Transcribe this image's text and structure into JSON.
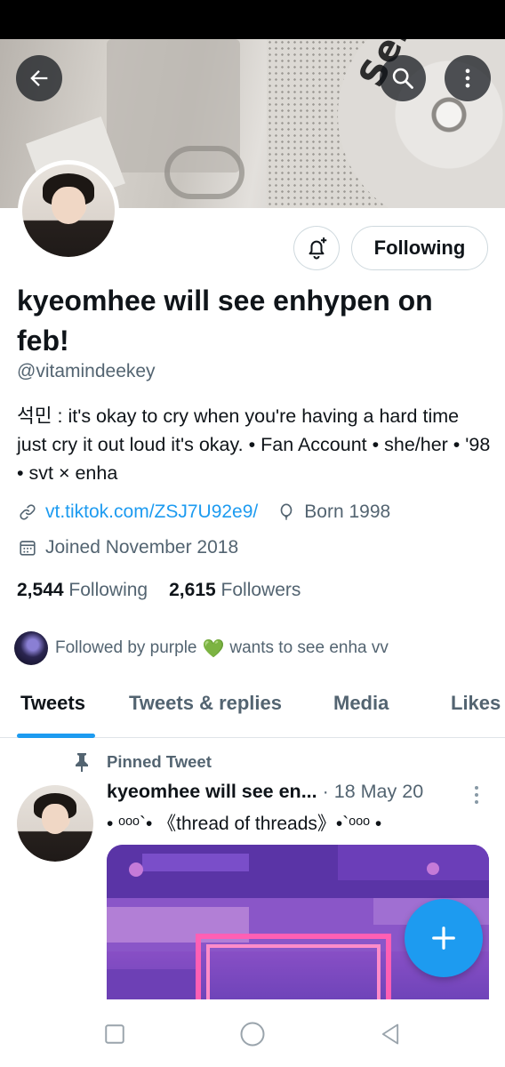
{
  "header": {
    "back_icon": "arrow-left-icon",
    "search_icon": "search-icon",
    "more_icon": "more-vertical-icon",
    "banner_text": "Semicolo"
  },
  "profile": {
    "display_name": "kyeomhee will see enhypen on feb!",
    "handle": "@vitamindeekey",
    "bio": "석민 : it's okay to cry when you're having a hard time just cry it out loud it's okay. • Fan Account • she/her • '98 • svt × enha",
    "link": "vt.tiktok.com/ZSJ7U92e9/",
    "birth": "Born 1998",
    "joined": "Joined November 2018",
    "following_count": "2,544",
    "following_label": "Following",
    "followers_count": "2,615",
    "followers_label": "Followers",
    "followed_by": "Followed by purple",
    "followed_by_suffix": "wants to see enha vv",
    "heart": "💚"
  },
  "actions": {
    "follow_button_label": "Following",
    "notify_icon": "bell-plus-icon"
  },
  "tabs": [
    {
      "label": "Tweets",
      "active": true
    },
    {
      "label": "Tweets & replies",
      "active": false
    },
    {
      "label": "Media",
      "active": false
    },
    {
      "label": "Likes",
      "active": false
    }
  ],
  "pinned_tweet": {
    "pinned_label": "Pinned Tweet",
    "author": "kyeomhee will see en...",
    "date": "· 18 May 20",
    "text": "• ᵒᵒᵒ`• 《thread of threads》•`ᵒᵒᵒ •"
  },
  "compose_icon": "plus-icon",
  "colors": {
    "accent": "#1d9bf0",
    "secondary_text": "#536471",
    "primary_text": "#0f1419",
    "heart": "#5bb84d"
  }
}
